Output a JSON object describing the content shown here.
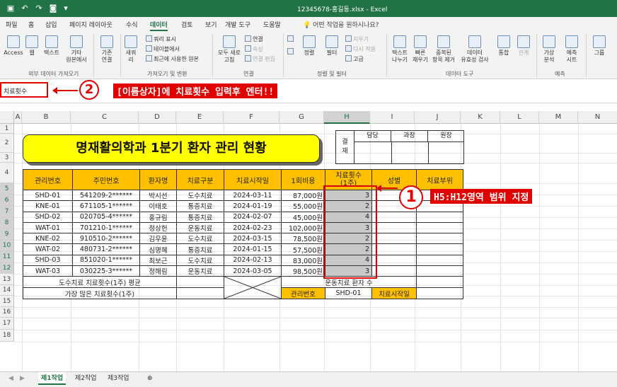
{
  "window": {
    "title": "12345678-홍길동.xlsx  -  Excel"
  },
  "tabs": [
    "파일",
    "홈",
    "삽입",
    "페이지 레이아웃",
    "수식",
    "데이터",
    "검토",
    "보기",
    "개발 도구",
    "도움말"
  ],
  "active_tab": "데이터",
  "tell_me": "어떤 작업을 원하시나요?",
  "ribbon": {
    "access": "Access",
    "web": "웹",
    "text": "텍스트",
    "other_sources": "기타\n원본에서",
    "existing_conn": "기존\n연결",
    "new_query": "새쿼\n리",
    "show_query": "쿼리 표시",
    "from_table": "테이블에서",
    "recent_sources": "최근에 사용한 원본",
    "refresh_all": "모두 새로\n고침",
    "connections": "연결",
    "properties": "속성",
    "edit_links": "연결 편집",
    "sort": "정렬",
    "filter": "필터",
    "clear": "지우기",
    "reapply": "다시 적용",
    "advanced": "고급",
    "text_to_columns": "텍스트\n나누기",
    "flash_fill": "빠른\n채우기",
    "remove_dup": "중복된\n항목 제거",
    "data_validation": "데이터\n유효성 검사",
    "consolidate": "통합",
    "relationships": "관계",
    "what_if": "가상\n분석",
    "forecast_sheet": "예측\n시트",
    "group": "그룹",
    "groups": {
      "external": "외부 데이터 가져오기",
      "get_transform": "가져오기 및 변환",
      "connections": "연결",
      "sort_filter": "정렬 및 필터",
      "data_tools": "데이터 도구",
      "forecast": "예측"
    }
  },
  "name_box": "치료횟수",
  "columns": [
    "A",
    "B",
    "C",
    "D",
    "E",
    "F",
    "G",
    "H",
    "I",
    "J",
    "K",
    "L",
    "M",
    "N"
  ],
  "rows": [
    "1",
    "2",
    "3",
    "4",
    "5",
    "6",
    "7",
    "8",
    "9",
    "10",
    "11",
    "12",
    "13",
    "14",
    "15",
    "16",
    "17",
    "18"
  ],
  "banner_title": "명재활의학과 1분기 환자 관리 현황",
  "approval": {
    "label": "결\n재",
    "cols": [
      "담당",
      "과장",
      "원장"
    ]
  },
  "table": {
    "headers": [
      "관리번호",
      "주민번호",
      "환자명",
      "치료구분",
      "치료시작일",
      "1회비용",
      "치료횟수\n(1주)",
      "성별",
      "치료부위"
    ],
    "rows": [
      [
        "SHD-01",
        "541209-2******",
        "박시선",
        "도수치료",
        "2024-03-11",
        "87,000원",
        "3",
        "",
        ""
      ],
      [
        "KNE-01",
        "671105-1******",
        "이태호",
        "통증치료",
        "2024-01-19",
        "55,000원",
        "2",
        "",
        ""
      ],
      [
        "SHD-02",
        "020705-4******",
        "홍규림",
        "통증치료",
        "2024-02-07",
        "45,000원",
        "4",
        "",
        ""
      ],
      [
        "WAT-01",
        "701210-1******",
        "정상헌",
        "운동치료",
        "2024-02-23",
        "102,000원",
        "3",
        "",
        ""
      ],
      [
        "KNE-02",
        "910510-2******",
        "김우윤",
        "도수치료",
        "2024-03-15",
        "78,500원",
        "2",
        "",
        ""
      ],
      [
        "WAT-02",
        "480731-2******",
        "심명혜",
        "통증치료",
        "2024-01-15",
        "57,500원",
        "2",
        "",
        ""
      ],
      [
        "SHD-03",
        "851020-1******",
        "최보근",
        "도수치료",
        "2024-02-13",
        "83,000원",
        "4",
        "",
        ""
      ],
      [
        "WAT-03",
        "030225-3******",
        "정해림",
        "운동치료",
        "2024-03-05",
        "98,500원",
        "3",
        "",
        ""
      ]
    ],
    "footer1": "도수치료 치료횟수(1주) 평균",
    "footer2": "가장 많은 치료횟수(1주)",
    "exercise_label": "운동치료 환자 수",
    "mgmt_no_label": "관리번호",
    "mgmt_no_value": "SHD-01",
    "start_date_label": "치료시작일"
  },
  "annotations": {
    "step1_num": "1",
    "step1_text": "H5:H12영역 범위 지정",
    "step2_num": "2",
    "step2_text": "[이름상자]에 치료횟수 입력후 엔터!!"
  },
  "sheets": [
    "제1작업",
    "제2작업",
    "제3작업"
  ],
  "active_sheet": "제1작업",
  "colors": {
    "excel_green": "#217346",
    "header_orange": "#ffc000",
    "banner_yellow": "#ffff00",
    "annotation_red": "#e00000"
  }
}
